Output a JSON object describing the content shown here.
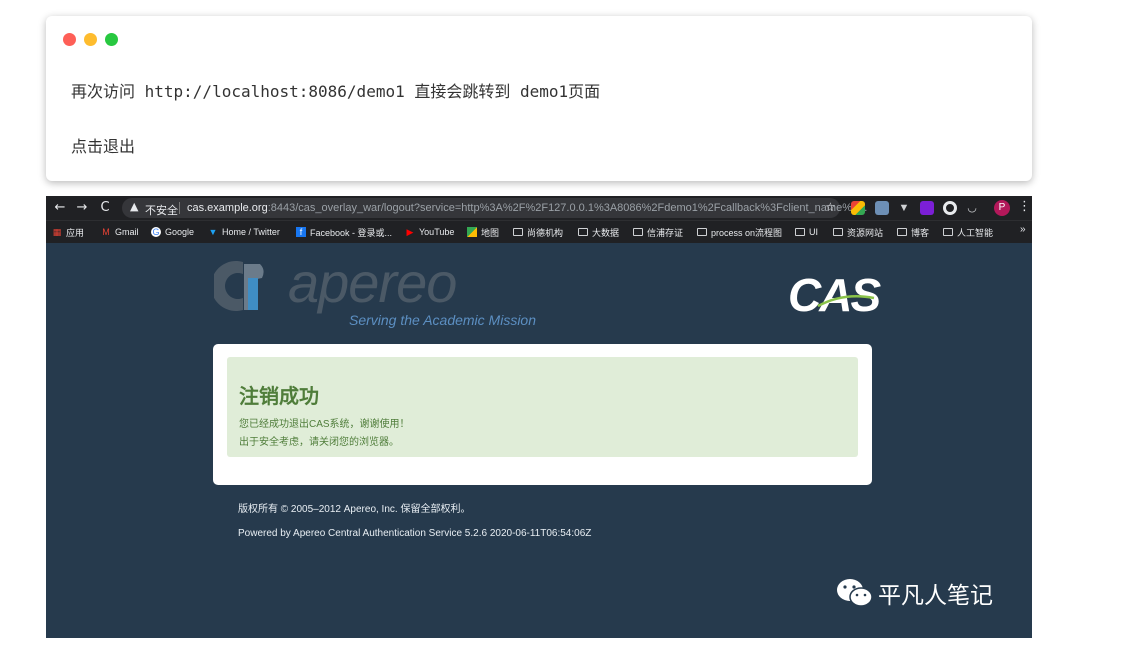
{
  "code_block": {
    "lines": [
      "再次访问 http://localhost:8086/demo1 直接会跳转到 demo1页面",
      "点击退出"
    ],
    "dot_colors": [
      "#fe5f57",
      "#febc2e",
      "#28c840"
    ]
  },
  "browser": {
    "nav": {
      "back": "←",
      "forward": "→",
      "reload": "C"
    },
    "address_bar": {
      "security_label": "不安全",
      "url_host": "cas.example.org",
      "url_rest": ":8443/cas_overlay_war/logout?service=http%3A%2F%2F127.0.0.1%3A8086%2Fdemo1%2Fcallback%3Fclient_name%3..."
    },
    "bookmarks": [
      {
        "label": "应用",
        "icon": "apps-icon"
      },
      {
        "label": "Gmail",
        "icon": "gmail-icon"
      },
      {
        "label": "Google",
        "icon": "google-icon"
      },
      {
        "label": "Home / Twitter",
        "icon": "twitter-icon"
      },
      {
        "label": "Facebook - 登录或...",
        "icon": "facebook-icon"
      },
      {
        "label": "YouTube",
        "icon": "youtube-icon"
      },
      {
        "label": "地图",
        "icon": "maps-icon"
      },
      {
        "label": "尚德机构",
        "icon": "folder-icon"
      },
      {
        "label": "大数据",
        "icon": "folder-icon"
      },
      {
        "label": "信浦存证",
        "icon": "folder-icon"
      },
      {
        "label": "process on流程图",
        "icon": "folder-icon"
      },
      {
        "label": "UI",
        "icon": "folder-icon"
      },
      {
        "label": "资源网站",
        "icon": "folder-icon"
      },
      {
        "label": "博客",
        "icon": "folder-icon"
      },
      {
        "label": "人工智能",
        "icon": "folder-icon"
      }
    ],
    "profile_initial": "P"
  },
  "page": {
    "brand": {
      "wordmark": "apereo",
      "tagline": "Serving the Academic Mission",
      "cas": "CAS"
    },
    "success": {
      "title": "注销成功",
      "message1": "您已经成功退出CAS系统，谢谢使用！",
      "message2": "出于安全考虑，请关闭您的浏览器。"
    },
    "footer": {
      "copyright": "版权所有 © 2005–2012 Apereo, Inc. 保留全部权利。",
      "powered": "Powered by Apereo Central Authentication Service 5.2.6 2020-06-11T06:54:06Z"
    },
    "watermark": "平凡人笔记"
  },
  "colors": {
    "page_bg": "#263a4d",
    "success_bg": "#e0edd8",
    "success_text": "#4f7d3a",
    "chrome_bg": "#202124"
  }
}
